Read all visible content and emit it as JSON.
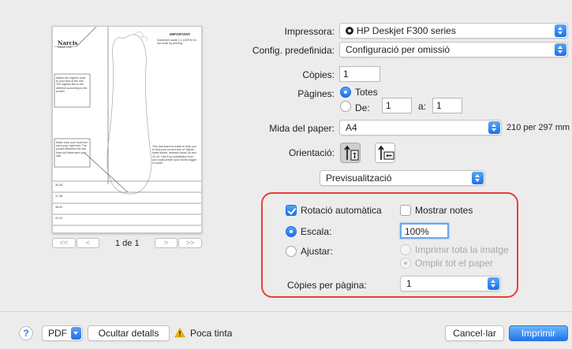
{
  "preview": {
    "page_label": "1 de 1",
    "first_btn": "<<",
    "prev_btn": "<",
    "next_btn": ">",
    "last_btn": ">>",
    "doc": {
      "logo_line1": "Narcis",
      "logo_line2": "Dance Line",
      "heading": "IMPORTANT",
      "scale_note": "Document scale 1:1 (100%) Do not scale by printing.",
      "instr_box1": "Attach the highest shoe to your foot at the line. The highest line is the different according to the pocket",
      "instr_box2": "Make sure your in person were your right foot. The pocket Between the two lines will determine your size",
      "right_text": "This document is made to help you to find your correct size of 'Narcis ballet shoes' between sizes 35 and 41-42. Use it by substitution from you could printer your shoes bigger or lower.",
      "sizes": [
        "35-36",
        "37-38",
        "38-40",
        "41-42"
      ]
    }
  },
  "settings": {
    "printer_label": "Impressora:",
    "printer_value": "HP Deskjet F300 series",
    "preset_label": "Config. predefinida:",
    "preset_value": "Configuració per omissió",
    "copies_label": "Còpies:",
    "copies_value": "1",
    "pages_label": "Pàgines:",
    "pages_all": "Totes",
    "pages_from": "De:",
    "pages_from_value": "1",
    "pages_to": "a:",
    "pages_to_value": "1",
    "paper_label": "Mida del paper:",
    "paper_value": "A4",
    "paper_dims": "210 per 297 mm",
    "orientation_label": "Orientació:",
    "section_value": "Previsualització"
  },
  "preview_options": {
    "auto_rotate": "Rotació automàtica",
    "show_notes": "Mostrar notes",
    "scale_label": "Escala:",
    "scale_value": "100%",
    "fit_label": "Ajustar:",
    "print_entire": "Imprimir tota la imatge",
    "fill_paper": "Omplir tot el paper",
    "copies_per_page_label": "Còpies per pàgina:",
    "copies_per_page_value": "1"
  },
  "footer": {
    "help": "?",
    "pdf": "PDF",
    "hide_details": "Ocultar detalls",
    "low_ink": "Poca tinta",
    "cancel": "Cancel·lar",
    "print": "Imprimir"
  },
  "colors": {
    "accent": "#1a72e8",
    "highlight_border": "#e8403a",
    "warning": "#f0b400"
  },
  "icons": {
    "printer_status": "printer-status-icon",
    "orientation_portrait": "portrait-orientation-icon",
    "orientation_landscape": "landscape-orientation-icon",
    "warning": "warning-triangle-icon",
    "help": "help-icon"
  }
}
